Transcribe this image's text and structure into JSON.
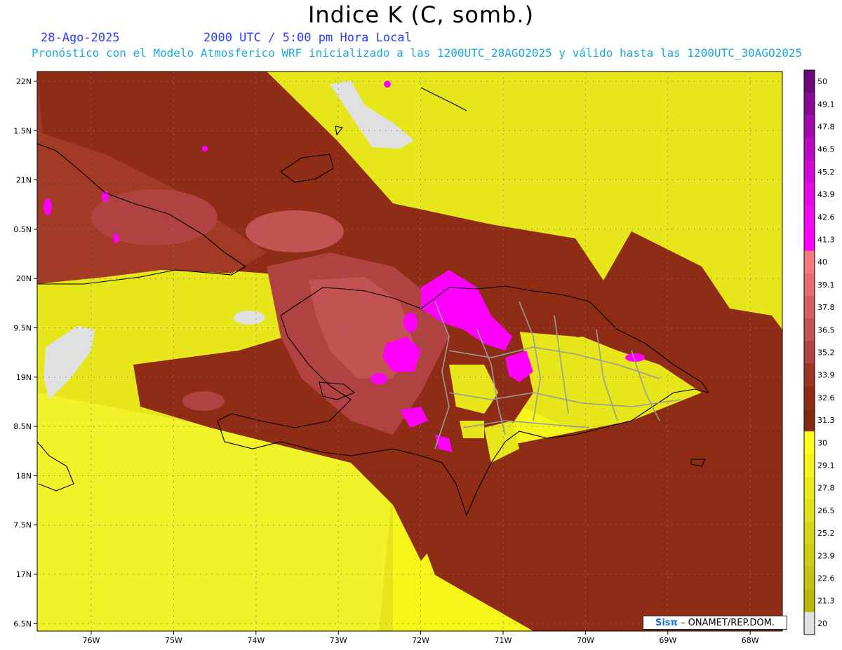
{
  "header": {
    "title": "Indice K (C, somb.)",
    "date": "28-Ago-2025",
    "time": "2000 UTC / 5:00 pm Hora Local",
    "description": "Pronóstico con el Modelo Atmosferico WRF inicializado a las 1200UTC_28AGO2025 y válido hasta las  1200UTC_30AGO2025"
  },
  "colors": {
    "header_text": "#2a3cff",
    "desc_text": "#1aa7e8"
  },
  "lat_ticks": [
    "22N",
    "1.5N",
    "21N",
    "0.5N",
    "20N",
    "9.5N",
    "19N",
    "8.5N",
    "18N",
    "7.5N",
    "17N",
    "6.5N"
  ],
  "lon_ticks": [
    "76W",
    "75W",
    "74W",
    "73W",
    "72W",
    "71W",
    "70W",
    "69W",
    "68W"
  ],
  "colorbar": {
    "levels": [
      "50",
      "49.1",
      "47.8",
      "46.5",
      "45.2",
      "43.9",
      "42.6",
      "41.3",
      "40",
      "39.1",
      "37.8",
      "36.5",
      "35.2",
      "33.9",
      "32.6",
      "31.3",
      "30",
      "29.1",
      "27.8",
      "26.5",
      "25.2",
      "23.9",
      "22.6",
      "21.3",
      "20"
    ],
    "colors": [
      "#6c0a7a",
      "#860a92",
      "#a10aac",
      "#bb0ac4",
      "#d20ad8",
      "#e40ae8",
      "#f20af3",
      "#ff00ff",
      "#f27a7a",
      "#e46e6e",
      "#d46060",
      "#c35252",
      "#b04242",
      "#9e3426",
      "#8f2c16",
      "#832a12",
      "#ffff1a",
      "#f4f41a",
      "#eaea1a",
      "#e0e01a",
      "#d6d61a",
      "#cccc15",
      "#c2c210",
      "#b8b80a",
      "#e0e0e0"
    ]
  },
  "credit": {
    "logo": "Sisπ",
    "text": "– ONAMET/REP.DOM."
  }
}
